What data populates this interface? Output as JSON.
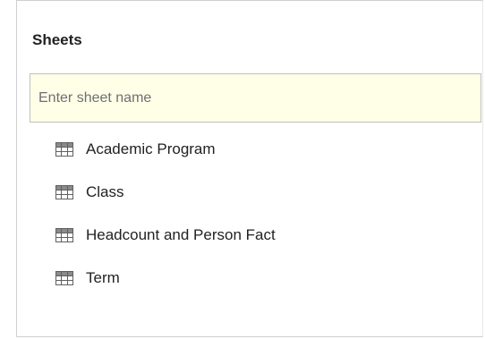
{
  "panel": {
    "title": "Sheets",
    "search": {
      "value": "",
      "placeholder": "Enter sheet name"
    },
    "icon_name": "table-grid-icon",
    "sheets": [
      {
        "label": "Academic Program"
      },
      {
        "label": "Class"
      },
      {
        "label": "Headcount and Person Fact"
      },
      {
        "label": "Term"
      }
    ]
  },
  "colors": {
    "search_background": "#ffffe8",
    "border": "#cfcfcf",
    "icon": "#606060"
  }
}
